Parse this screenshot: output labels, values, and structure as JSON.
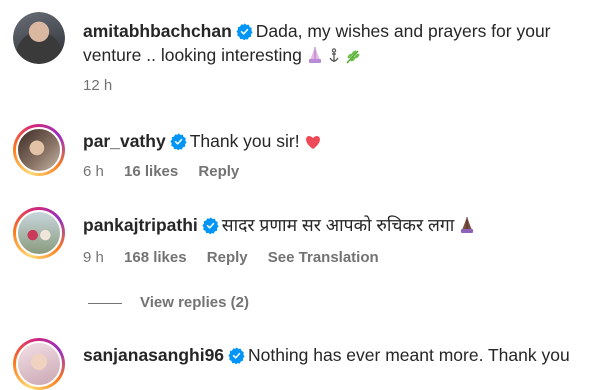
{
  "comments": [
    {
      "username": "amitabhbachchan",
      "verified": true,
      "text_line1": "Dada, my wishes and prayers for your",
      "text_line2": "venture .. looking interesting",
      "time": "12 h"
    },
    {
      "username": "par_vathy",
      "verified": true,
      "text": "Thank you sir!",
      "time": "6 h",
      "likes": "16 likes",
      "reply": "Reply"
    },
    {
      "username": "pankajtripathi",
      "verified": true,
      "text": "सादर प्रणाम सर आपको रुचिकर लगा",
      "time": "9 h",
      "likes": "168 likes",
      "reply": "Reply",
      "translation": "See Translation"
    },
    {
      "username": "sanjanasanghi96",
      "verified": true,
      "text": "Nothing has ever meant more. Thank you"
    }
  ],
  "view_replies": "View replies (2)",
  "colors": {
    "verified": "#0095f6",
    "meta": "#737373",
    "heart": "#ed4956"
  }
}
